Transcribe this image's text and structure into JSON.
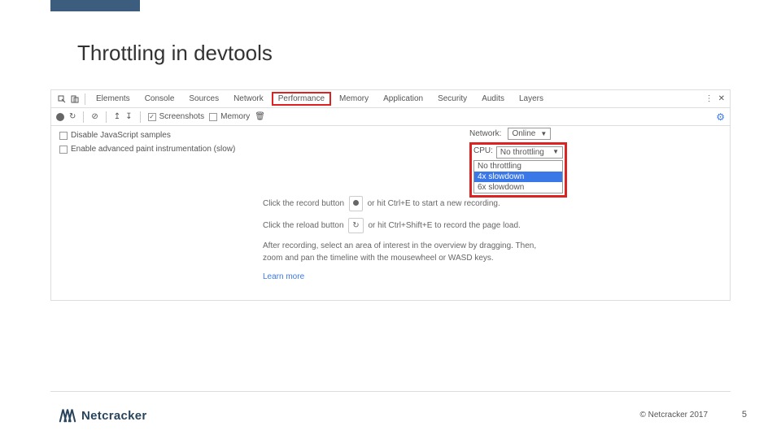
{
  "title": "Throttling in devtools",
  "tabs": [
    "Elements",
    "Console",
    "Sources",
    "Network",
    "Performance",
    "Memory",
    "Application",
    "Security",
    "Audits",
    "Layers"
  ],
  "activeTab": "Performance",
  "toolbar": {
    "screenshots": "Screenshots",
    "memory": "Memory"
  },
  "options": {
    "disableJs": "Disable JavaScript samples",
    "enableAdv": "Enable advanced paint instrumentation (slow)"
  },
  "network": {
    "label": "Network:",
    "value": "Online"
  },
  "cpu": {
    "label": "CPU:",
    "value": "No throttling",
    "options": [
      "No throttling",
      "4x slowdown",
      "6x slowdown"
    ],
    "selected": "4x slowdown"
  },
  "hints": {
    "record_pre": "Click the record button",
    "record_post": "or hit Ctrl+E to start a new recording.",
    "reload_pre": "Click the reload button",
    "reload_post": "or hit Ctrl+Shift+E to record the page load.",
    "after": "After recording, select an area of interest in the overview by dragging. Then, zoom and pan the timeline with the mousewheel or WASD keys.",
    "learn": "Learn more"
  },
  "footer": {
    "brand": "Netcracker",
    "copyright": "© Netcracker 2017",
    "page": "5"
  }
}
